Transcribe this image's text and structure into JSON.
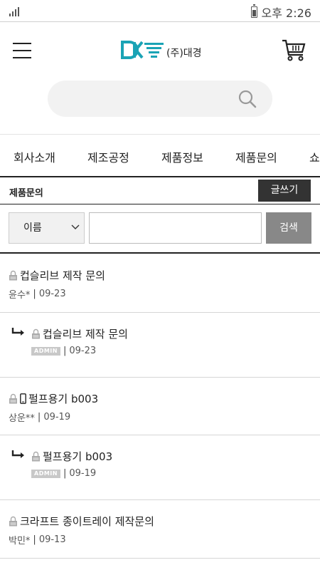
{
  "status_bar": {
    "time": "오후 2:26"
  },
  "header": {
    "brand": "(주)대경",
    "logo_letters": "DK"
  },
  "search": {
    "value": ""
  },
  "nav": {
    "items": [
      "회사소개",
      "제조공정",
      "제품정보",
      "제품문의",
      "쇼"
    ]
  },
  "board": {
    "title": "제품문의",
    "write_label": "글쓰기"
  },
  "filter": {
    "selected": "이름",
    "value": "",
    "button_label": "검색"
  },
  "admin_label": "ADMIN",
  "posts": [
    {
      "title": "컵슬리브 제작 문의",
      "author": "윤수*",
      "date": "09-23"
    },
    {
      "title": "컵슬리브 제작 문의",
      "author": "",
      "date": "09-23"
    },
    {
      "title": "펄프용기 b003",
      "author": "상운**",
      "date": "09-19"
    },
    {
      "title": "펄프용기 b003",
      "author": "",
      "date": "09-19"
    },
    {
      "title": "크라프트 종이트레이 제작문의",
      "author": "박민*",
      "date": "09-13"
    }
  ],
  "colors": {
    "brand": "#1aa3b5",
    "dark": "#333333",
    "button_gray": "#888888"
  }
}
